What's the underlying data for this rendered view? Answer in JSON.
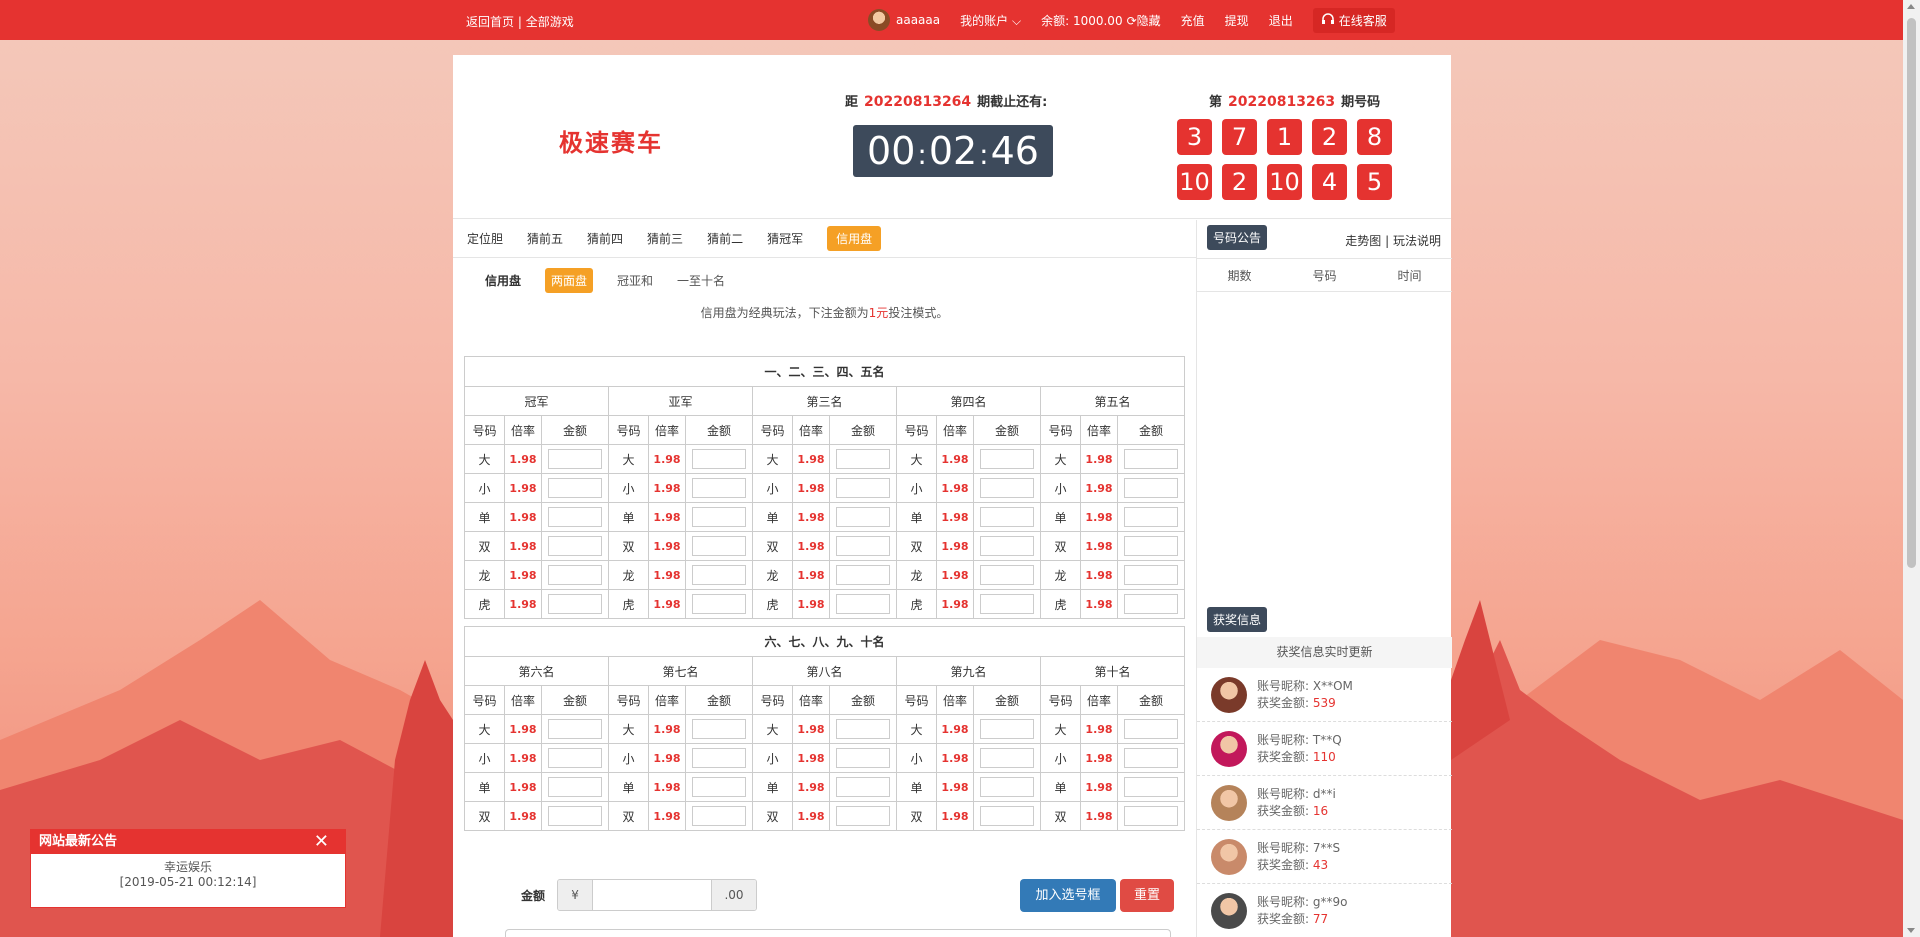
{
  "topbar": {
    "home": "返回首页",
    "sep": " | ",
    "all_games": "全部游戏",
    "username": "aaaaaa",
    "my_account": "我的账户",
    "balance_label": "余额:",
    "balance_value": "1000.00",
    "hide": "隐藏",
    "recharge": "充值",
    "withdraw": "提现",
    "logout": "退出",
    "service": "在线客服"
  },
  "header": {
    "game_title": "极速赛车",
    "next_prefix": "距",
    "next_issue": "20220813264",
    "next_suffix": "期截止还有:",
    "timer": {
      "h": "00",
      "sep": ":",
      "m": "02",
      "s": "46"
    },
    "last_prefix": "第",
    "last_issue": "20220813263",
    "last_suffix": "期号码",
    "balls": [
      "3",
      "7",
      "1",
      "2",
      "8",
      "10",
      "2",
      "10",
      "4",
      "5"
    ]
  },
  "tabs": [
    "定位胆",
    "猜前五",
    "猜前四",
    "猜前三",
    "猜前二",
    "猜冠军",
    "信用盘"
  ],
  "active_tab": "信用盘",
  "subtabs": {
    "label": "信用盘",
    "items": [
      "两面盘",
      "冠亚和",
      "一至十名"
    ]
  },
  "note": {
    "pre": "信用盘为经典玩法，下注金额为",
    "red": "1元",
    "post": "投注模式。"
  },
  "table1": {
    "title": "一、二、三、四、五名",
    "groups": [
      "冠军",
      "亚军",
      "第三名",
      "第四名",
      "第五名"
    ],
    "rows": [
      "大",
      "小",
      "单",
      "双",
      "龙",
      "虎"
    ]
  },
  "table2": {
    "title": "六、七、八、九、十名",
    "groups": [
      "第六名",
      "第七名",
      "第八名",
      "第九名",
      "第十名"
    ],
    "rows": [
      "大",
      "小",
      "单",
      "双"
    ]
  },
  "col_headers": {
    "code": "号码",
    "odds": "倍率",
    "amount": "金额"
  },
  "odds_value": "1.98",
  "amount_row": {
    "label": "金额",
    "currency": "¥",
    "suffix": ".00",
    "add": "加入选号框",
    "reset": "重置"
  },
  "sidebar": {
    "notice_badge": "号码公告",
    "trend": "走势图",
    "sep": " | ",
    "rules": "玩法说明",
    "cols": [
      "期数",
      "号码",
      "时间"
    ],
    "win_badge": "获奖信息",
    "win_bar": "获奖信息实时更新",
    "name_label": "账号昵称:",
    "amount_label": "获奖金额:",
    "winners": [
      {
        "name": "X**OM",
        "amount": "539",
        "color": "#7a3a2a"
      },
      {
        "name": "T**Q",
        "amount": "110",
        "color": "#c2185b"
      },
      {
        "name": "d**i",
        "amount": "16",
        "color": "#b5835a"
      },
      {
        "name": "7**S",
        "amount": "43",
        "color": "#c98a6a"
      },
      {
        "name": "g**9o",
        "amount": "77",
        "color": "#4a4a4a"
      }
    ]
  },
  "notice": {
    "title": "网站最新公告",
    "close": "✕",
    "line1": "幸运娱乐",
    "line2": "[2019-05-21 00:12:14]"
  }
}
